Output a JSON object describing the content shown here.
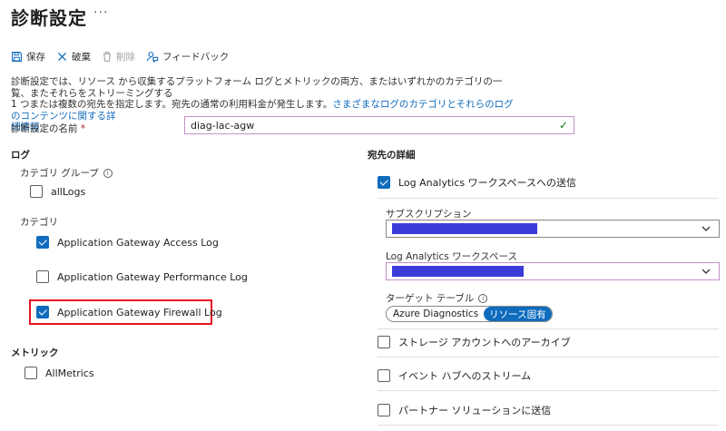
{
  "page": {
    "title": "診断設定",
    "more": "···"
  },
  "toolbar": {
    "save": "保存",
    "discard": "破棄",
    "delete": "削除",
    "feedback": "フィードバック"
  },
  "description": {
    "line1": "診断設定では、リソース から収集するプラットフォーム ログとメトリックの両方、またはいずれかのカテゴリの一覧、またそれらをストリーミングする",
    "line2": "1 つまたは複数の宛先を指定します。宛先の通常の利用料金が発生します。",
    "link_a": "さまざまなログのカテゴリとそれらのログのコンテンツに関する詳",
    "link_b": "細情報"
  },
  "name_field": {
    "label": "診断設定の名前",
    "required_mark": "*",
    "value": "diag-lac-agw"
  },
  "logs": {
    "heading": "ログ",
    "category_group_label": "カテゴリ グループ",
    "all_logs": "allLogs",
    "category_label": "カテゴリ",
    "access_log": "Application Gateway Access Log",
    "performance_log": "Application Gateway Performance Log",
    "firewall_log": "Application Gateway Firewall Log"
  },
  "metrics": {
    "heading": "メトリック",
    "all_metrics": "AllMetrics"
  },
  "destination": {
    "heading": "宛先の詳細",
    "send_la": "Log Analytics ワークスペースへの送信",
    "subscription_label": "サブスクリプション",
    "workspace_label": "Log Analytics ワークスペース",
    "target_table_label": "ターゲット テーブル",
    "table_azure_diag": "Azure Diagnostics",
    "table_resource_specific": "リソース固有",
    "archive_storage": "ストレージ アカウントへのアーカイブ",
    "stream_event_hub": "イベント ハブへのストリーム",
    "partner_solution": "パートナー ソリューションに送信"
  },
  "colors": {
    "accent": "#0f6cbd",
    "redacted": "#3b3bd8",
    "highlight": "#e81123"
  }
}
